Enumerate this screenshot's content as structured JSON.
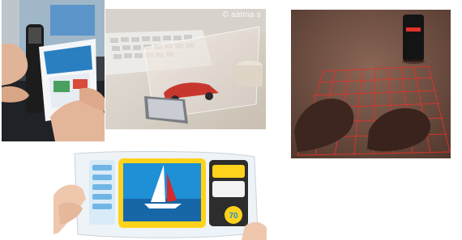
{
  "photos": [
    {
      "subject": "handheld-device-with-flexible-display"
    },
    {
      "subject": "phone-with-transparent-holographic-screen",
      "watermark": "© aatma s"
    },
    {
      "subject": "laser-projection-keyboard"
    },
    {
      "subject": "flexible-transparent-tablet"
    }
  ],
  "display_values": {
    "dial_number": "70"
  },
  "colors": {
    "background": "#ffffff",
    "laser_red": "#e2322a",
    "sea_blue": "#1f8fd6",
    "screen_yellow": "#ffd21c",
    "desk_brown": "#6e4a3a"
  }
}
